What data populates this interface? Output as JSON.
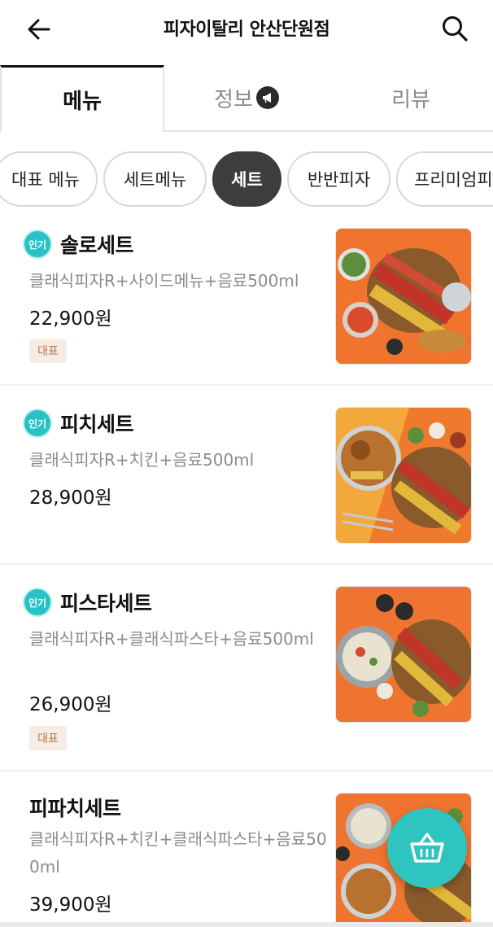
{
  "header": {
    "title": "피자이탈리 안산단원점",
    "back_icon": "arrow-left-icon",
    "search_icon": "search-icon"
  },
  "tabs": [
    {
      "label": "메뉴",
      "active": true
    },
    {
      "label": "정보",
      "active": false,
      "badge_icon": "megaphone-icon"
    },
    {
      "label": "리뷰",
      "active": false
    }
  ],
  "categories": [
    {
      "label": "대표 메뉴",
      "active": false
    },
    {
      "label": "세트메뉴",
      "active": false
    },
    {
      "label": "세트",
      "active": true
    },
    {
      "label": "반반피자",
      "active": false
    },
    {
      "label": "프리미엄피",
      "active": false
    }
  ],
  "menu_items": [
    {
      "badge": "인기",
      "name": "솔로세트",
      "description": "클래식피자R+사이드메뉴+음료500ml",
      "price": "22,900원",
      "tag": "대표"
    },
    {
      "badge": "인기",
      "name": "피치세트",
      "description": "클래식피자R+치킨+음료500ml",
      "price": "28,900원",
      "tag": ""
    },
    {
      "badge": "인기",
      "name": "피스타세트",
      "description": "클래식피자R+클래식파스타+음료500ml",
      "price": "26,900원",
      "tag": "대표"
    },
    {
      "badge": "",
      "name": "피파치세트",
      "description": "클래식피자R+치킨+클래식파스타+음료500ml",
      "price": "39,900원",
      "tag": ""
    }
  ],
  "cart_icon": "basket-icon",
  "colors": {
    "accent": "#2fc4bf",
    "badge": "#28c2c6",
    "chip_active": "#3d3d3d",
    "tag_bg": "#f6ece3",
    "tag_text": "#b57a4f"
  }
}
